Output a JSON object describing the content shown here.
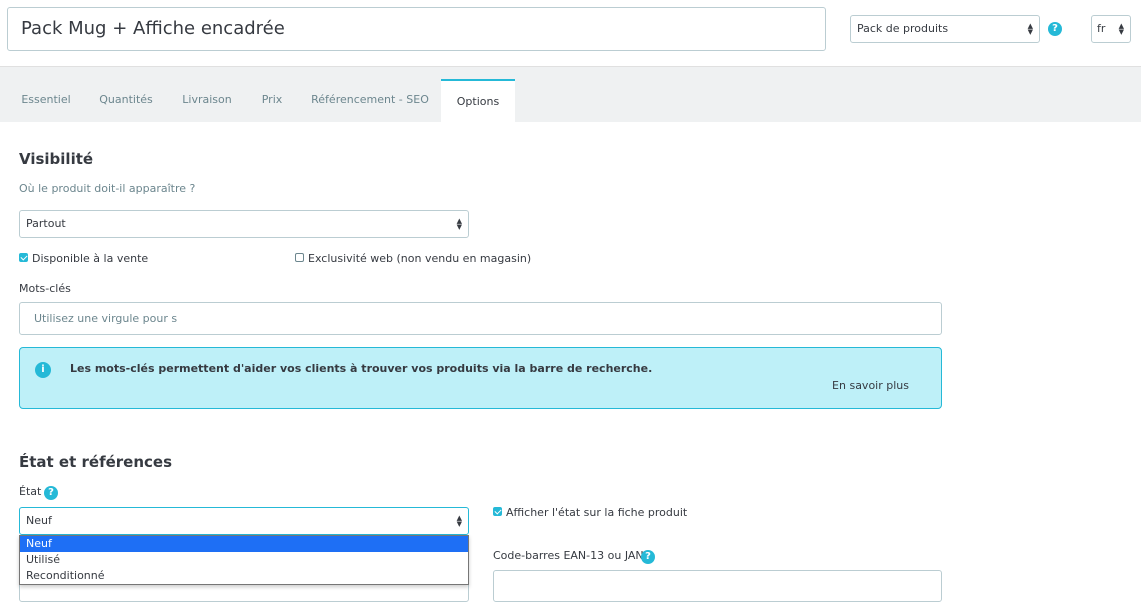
{
  "header": {
    "product_name": "Pack Mug + Affiche encadrée",
    "product_type": "Pack de produits",
    "help_symbol": "?",
    "language": "fr"
  },
  "tabs": [
    {
      "label": "Essentiel"
    },
    {
      "label": "Quantités"
    },
    {
      "label": "Livraison"
    },
    {
      "label": "Prix"
    },
    {
      "label": "Référencement - SEO"
    },
    {
      "label": "Options"
    }
  ],
  "active_tab": "Options",
  "visibility": {
    "title": "Visibilité",
    "question": "Où le produit doit-il apparaître ?",
    "selected": "Partout",
    "available_label": "Disponible à la vente",
    "available_checked": true,
    "web_only_label": "Exclusivité web (non vendu en magasin)",
    "web_only_checked": false
  },
  "keywords": {
    "label": "Mots-clés",
    "placeholder": "Utilisez une virgule pour s",
    "info_symbol": "i",
    "info_text": "Les mots-clés permettent d'aider vos clients à trouver vos produits via la barre de recherche.",
    "learn_more": "En savoir plus"
  },
  "condition": {
    "title": "État et références",
    "label": "État",
    "help_symbol": "?",
    "selected": "Neuf",
    "options": [
      "Neuf",
      "Utilisé",
      "Reconditionné"
    ],
    "show_condition_label": "Afficher l'état sur la fiche produit",
    "show_condition_checked": true
  },
  "barcode": {
    "label": "Code-barres EAN-13 ou JAN",
    "help_symbol": "?"
  },
  "colors": {
    "accent": "#25b9d7",
    "alert_bg": "#bef0f8",
    "selected_option": "#1e6ff5"
  }
}
